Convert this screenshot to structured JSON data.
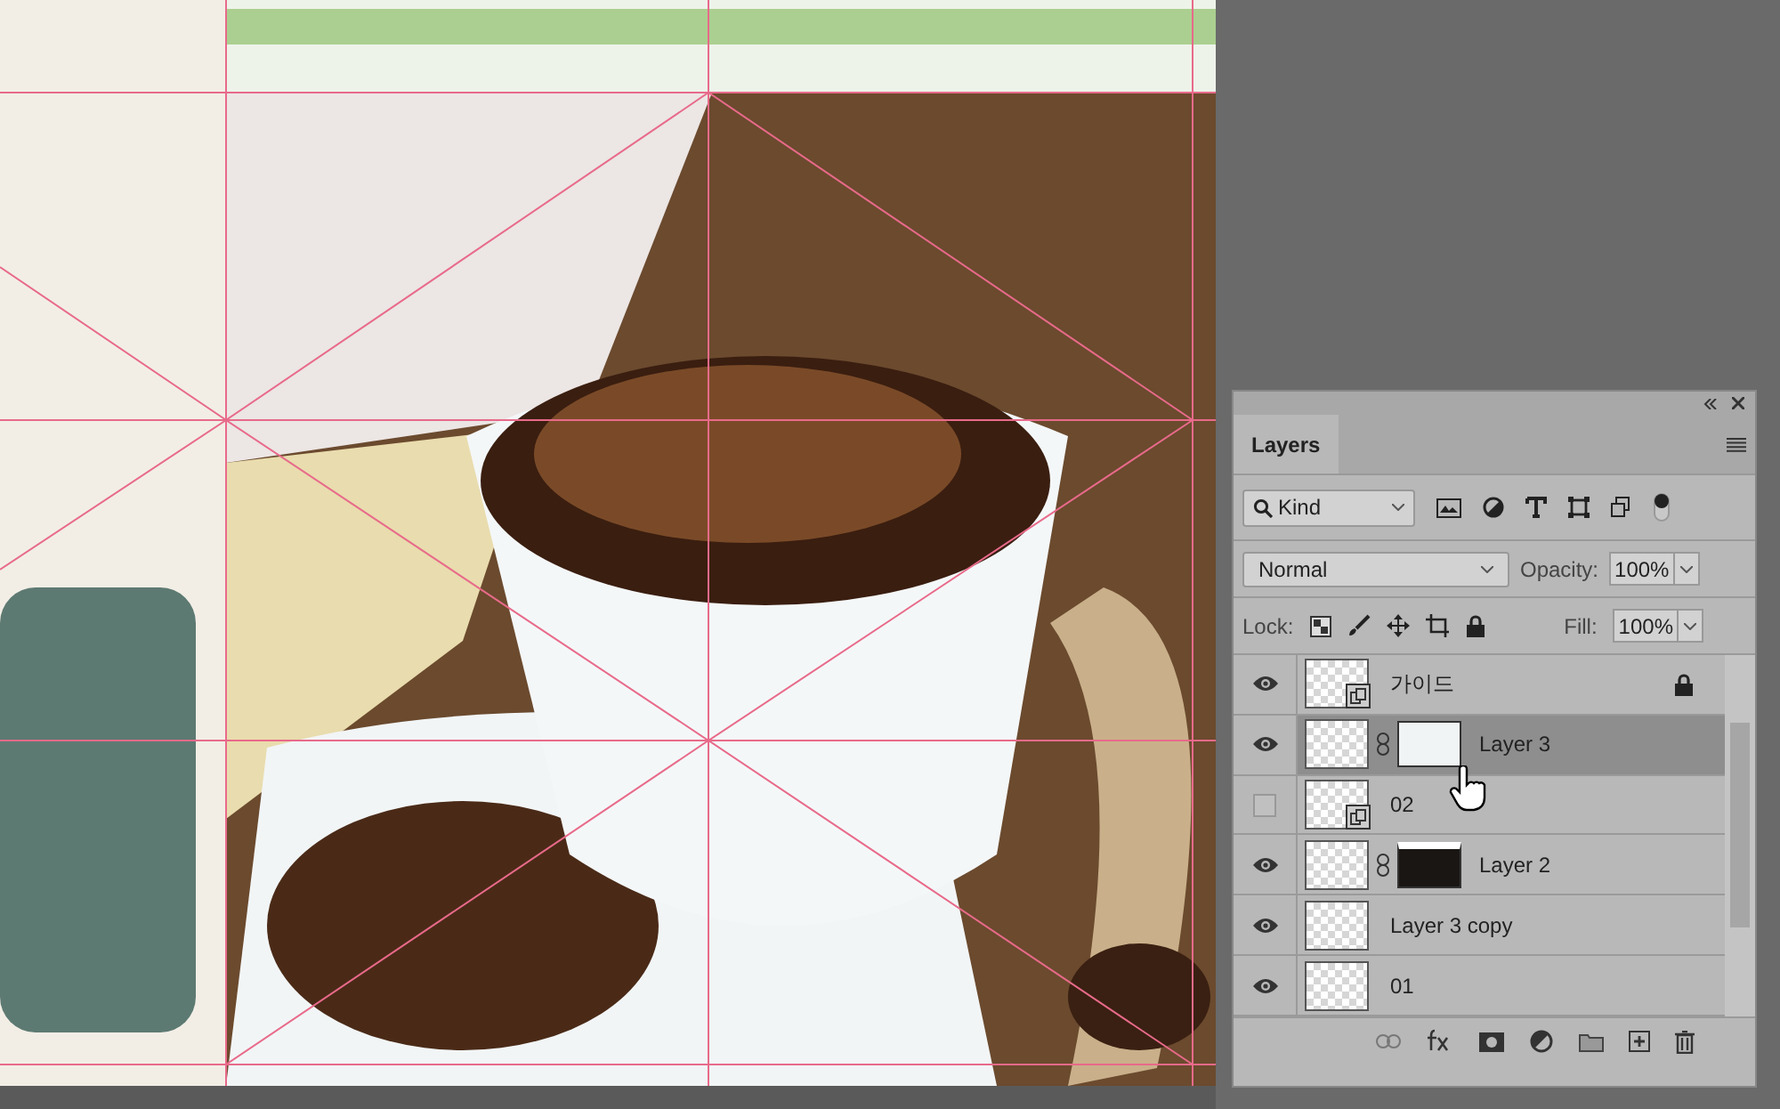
{
  "panel": {
    "tab": "Layers",
    "filter": {
      "value": "Kind"
    },
    "blend_mode": {
      "value": "Normal"
    },
    "opacity": {
      "label": "Opacity:",
      "value": "100%"
    },
    "lock": {
      "label": "Lock:"
    },
    "fill": {
      "label": "Fill:",
      "value": "100%"
    },
    "layers": [
      {
        "name": "가이드",
        "visible": true,
        "selected": false,
        "locked": true,
        "kind": "smart"
      },
      {
        "name": "Layer 3",
        "visible": true,
        "selected": true,
        "locked": false,
        "kind": "masked",
        "mask_dark": false
      },
      {
        "name": "02",
        "visible": false,
        "selected": false,
        "locked": false,
        "kind": "smart"
      },
      {
        "name": "Layer 2",
        "visible": true,
        "selected": false,
        "locked": false,
        "kind": "masked",
        "mask_dark": true
      },
      {
        "name": "Layer 3 copy",
        "visible": true,
        "selected": false,
        "locked": false,
        "kind": "plain"
      },
      {
        "name": "01",
        "visible": true,
        "selected": false,
        "locked": false,
        "kind": "plain"
      }
    ]
  }
}
